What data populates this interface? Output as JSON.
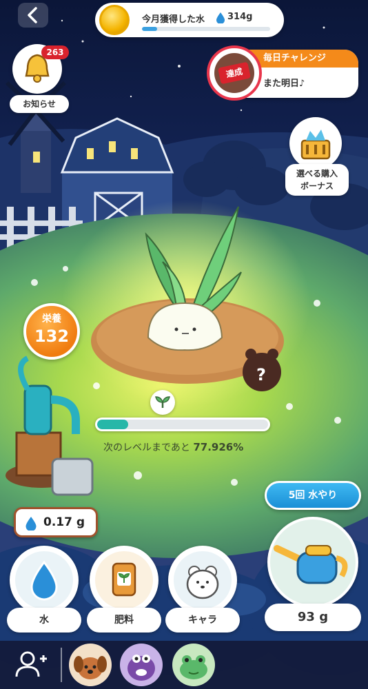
{
  "header": {
    "water_month_label": "今月獲得した水",
    "water_month_value": "314g",
    "water_month_progress": 0.12
  },
  "notification": {
    "badge": "263",
    "label": "お知らせ"
  },
  "challenge": {
    "title": "毎日チャレンジ",
    "status": "また明日♪",
    "stamp": "達成"
  },
  "bonus": {
    "label_line1": "選べる購入",
    "label_line2": "ボーナス"
  },
  "nutrition": {
    "title": "栄養",
    "value": "132"
  },
  "level": {
    "progress": 0.18,
    "text_prefix": "次のレベルまであと",
    "percent": "77.926%"
  },
  "water_amount": "0.17 g",
  "water_times_button": "5回 水やり",
  "actions": {
    "water_label": "水",
    "fertilizer_label": "肥料",
    "character_label": "キャラ",
    "can_label": "93 g"
  },
  "colors": {
    "accent_orange": "#f48a1a",
    "accent_blue": "#1a8fd6",
    "progress_teal": "#27b7a8",
    "badge_red": "#d9232d"
  },
  "icons": {
    "back": "chevron-left-icon",
    "coin": "water-coin-icon",
    "bell": "bell-icon",
    "basket": "gift-basket-icon",
    "sprout": "sprout-icon",
    "pump": "water-pump-icon",
    "drop": "water-drop-icon",
    "fertilizer": "fertilizer-bag-icon",
    "character": "hamster-character-icon",
    "watering_can": "watering-can-icon",
    "add_friend": "add-friend-icon"
  }
}
